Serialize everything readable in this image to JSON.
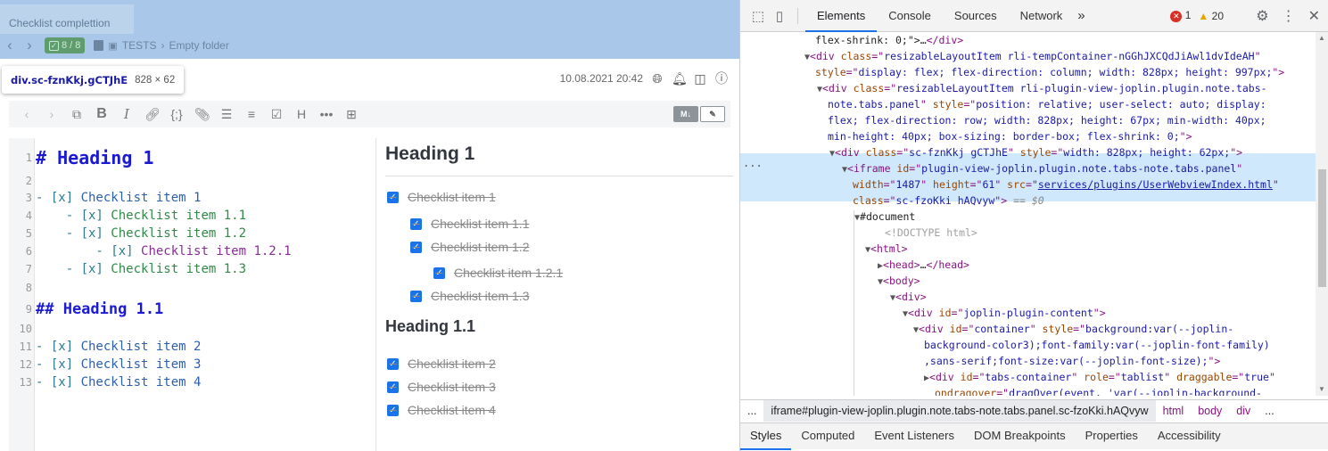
{
  "app": {
    "tab_title": "Checklist complettion",
    "navbar": {
      "back_icon": "chevron-left",
      "forward_icon": "chevron-right",
      "todo_badge": "8 / 8",
      "notebook": "TESTS",
      "folder": "Empty folder"
    },
    "tooltip": {
      "selector": "div.sc-fznKkj.gCTJhE",
      "size": "828 × 62"
    },
    "header": {
      "datetime": "10.08.2021 20:42"
    },
    "editor_toolbar": {
      "toggle_markdown": "M↓",
      "toggle_edit": "✎"
    },
    "editor_lines": [
      {
        "n": "1",
        "text": "# Heading 1",
        "kind": "h1"
      },
      {
        "n": "2",
        "text": "",
        "kind": "blank"
      },
      {
        "n": "3",
        "mark": "- [x] ",
        "text": "Checklist item 1",
        "kind": "l0"
      },
      {
        "n": "4",
        "mark": "    - [x] ",
        "text": "Checklist item 1.1",
        "kind": "l1"
      },
      {
        "n": "5",
        "mark": "    - [x] ",
        "text": "Checklist item 1.2",
        "kind": "l1"
      },
      {
        "n": "6",
        "mark": "        - [x] ",
        "text": "Checklist item 1.2.1",
        "kind": "l2"
      },
      {
        "n": "7",
        "mark": "    - [x] ",
        "text": "Checklist item 1.3",
        "kind": "l1"
      },
      {
        "n": "8",
        "text": "",
        "kind": "blank"
      },
      {
        "n": "9",
        "text": "## Heading 1.1",
        "kind": "h2"
      },
      {
        "n": "10",
        "text": "",
        "kind": "blank"
      },
      {
        "n": "11",
        "mark": "- [x] ",
        "text": "Checklist item 2",
        "kind": "l0"
      },
      {
        "n": "12",
        "mark": "- [x] ",
        "text": "Checklist item 3",
        "kind": "l0"
      },
      {
        "n": "13",
        "mark": "- [x] ",
        "text": "Checklist item 4",
        "kind": "l0"
      }
    ],
    "viewer": {
      "heading1": "Heading 1",
      "items1": [
        {
          "text": "Checklist item 1",
          "level": 0
        },
        {
          "text": "Checklist item 1.1",
          "level": 1
        },
        {
          "text": "Checklist item 1.2",
          "level": 1
        },
        {
          "text": "Checklist item 1.2.1",
          "level": 2
        },
        {
          "text": "Checklist item 1.3",
          "level": 1
        }
      ],
      "heading2": "Heading 1.1",
      "items2": [
        {
          "text": "Checklist item 2",
          "level": 0
        },
        {
          "text": "Checklist item 3",
          "level": 0
        },
        {
          "text": "Checklist item 4",
          "level": 0
        }
      ]
    }
  },
  "devtools": {
    "tabs": [
      "Elements",
      "Console",
      "Sources",
      "Network"
    ],
    "active_tab": "Elements",
    "more_tabs": "»",
    "errors": "1",
    "warnings": "20",
    "dom_lines": [
      {
        "indent": 0,
        "html": "<span class=\"tx\">flex-shrink: 0;\">…</span><span class=\"t\">&lt;/div&gt;</span>"
      },
      {
        "indent": 0,
        "html": "<span class=\"tri\">▼</span><span class=\"t\">&lt;div </span><span class=\"an\">class</span><span class=\"t\">=\"</span><span class=\"av\">resizableLayoutItem rli-tempContainer-nGGhJXCQdJiAwl1dvIdeAH</span><span class=\"t\">\"</span>"
      },
      {
        "indent": 0,
        "html": "<span class=\"an\">style</span><span class=\"t\">=\"</span><span class=\"av\">display: flex; flex-direction: column; width: 828px; height: 997px;</span><span class=\"t\">\"&gt;</span>"
      },
      {
        "indent": 1,
        "html": "<span class=\"tri\">▼</span><span class=\"t\">&lt;div </span><span class=\"an\">class</span><span class=\"t\">=\"</span><span class=\"av\">resizableLayoutItem rli-plugin-view-joplin.plugin.note.tabs-</span>"
      },
      {
        "indent": 1,
        "html": "<span class=\"av\">note.tabs.panel</span><span class=\"t\">\" </span><span class=\"an\">style</span><span class=\"t\">=\"</span><span class=\"av\">position: relative; user-select: auto; display:</span>"
      },
      {
        "indent": 1,
        "html": "<span class=\"av\">flex; flex-direction: row; width: 828px; height: 67px; min-width: 40px;</span>"
      },
      {
        "indent": 1,
        "html": "<span class=\"av\">min-height: 40px; box-sizing: border-box; flex-shrink: 0;</span><span class=\"t\">\"&gt;</span>"
      },
      {
        "indent": 2,
        "html": "<span class=\"tri\">▼</span><span class=\"t\">&lt;div </span><span class=\"an\">class</span><span class=\"t\">=\"</span><span class=\"av\">sc-fznKkj gCTJhE</span><span class=\"t\">\" </span><span class=\"an\">style</span><span class=\"t\">=\"</span><span class=\"av\">width: 828px; height: 62px;</span><span class=\"t\">\"&gt;</span>"
      },
      {
        "indent": 3,
        "html": "<span class=\"tri\">▼</span><span class=\"t\">&lt;iframe </span><span class=\"an\">id</span><span class=\"t\">=\"</span><span class=\"av\">plugin-view-joplin.plugin.note.tabs-note.tabs.panel</span><span class=\"t\">\"</span>"
      },
      {
        "indent": 3,
        "html": "<span class=\"an\">width</span><span class=\"t\">=\"</span><span class=\"av\">1487</span><span class=\"t\">\" </span><span class=\"an\">height</span><span class=\"t\">=\"</span><span class=\"av\">61</span><span class=\"t\">\" </span><span class=\"an\">src</span><span class=\"t\">=\"</span><span class=\"lk\">services/plugins/UserWebviewIndex.html</span><span class=\"t\">\"</span>"
      },
      {
        "indent": 3,
        "html": "<span class=\"an\">class</span><span class=\"t\">=\"</span><span class=\"av\">sc-fzoKki hAQvyw</span><span class=\"t\">\"&gt;</span> <span class=\"eq\">== $0</span>"
      },
      {
        "indent": 4,
        "html": "<span class=\"tri\">▼</span><span class=\"tx\">#document</span>"
      },
      {
        "indent": 5,
        "html": "<span class=\"cm\">&lt;!DOCTYPE html&gt;</span>"
      },
      {
        "indent": 5,
        "html": "<span class=\"tri\">▼</span><span class=\"t\">&lt;html&gt;</span>"
      },
      {
        "indent": 6,
        "html": "<span class=\"tri\">▶</span><span class=\"t\">&lt;head&gt;</span><span class=\"tx\">…</span><span class=\"t\">&lt;/head&gt;</span>"
      },
      {
        "indent": 6,
        "html": "<span class=\"tri\">▼</span><span class=\"t\">&lt;body&gt;</span>"
      },
      {
        "indent": 7,
        "html": "<span class=\"tri\">▼</span><span class=\"t\">&lt;div&gt;</span>"
      },
      {
        "indent": 8,
        "html": "<span class=\"tri\">▼</span><span class=\"t\">&lt;div </span><span class=\"an\">id</span><span class=\"t\">=\"</span><span class=\"av\">joplin-plugin-content</span><span class=\"t\">\"&gt;</span>"
      },
      {
        "indent": 9,
        "html": "<span class=\"tri\">▼</span><span class=\"t\">&lt;div </span><span class=\"an\">id</span><span class=\"t\">=\"</span><span class=\"av\">container</span><span class=\"t\">\" </span><span class=\"an\">style</span><span class=\"t\">=\"</span><span class=\"av\">background:var(--joplin-</span>"
      },
      {
        "indent": 9,
        "html": "<span class=\"av\">background-color3);font-family:var(--joplin-font-family)</span>"
      },
      {
        "indent": 9,
        "html": "<span class=\"av\">,sans-serif;font-size:var(--joplin-font-size);</span><span class=\"t\">\"&gt;</span>"
      },
      {
        "indent": 10,
        "html": "<span class=\"tri\">▶</span><span class=\"t\">&lt;div </span><span class=\"an\">id</span><span class=\"t\">=\"</span><span class=\"av\">tabs-container</span><span class=\"t\">\" </span><span class=\"an\">role</span><span class=\"t\">=\"</span><span class=\"av\">tablist</span><span class=\"t\">\" </span><span class=\"an\">draggable</span><span class=\"t\">=\"</span><span class=\"av\">true</span><span class=\"t\">\"</span>"
      },
      {
        "indent": 10,
        "html": "<span class=\"an\">ondragover</span><span class=\"t\">=\"</span><span class=\"av\">dragOver(event, 'var(--joplin-background-</span>"
      }
    ],
    "breadcrumb": [
      "...",
      "iframe#plugin-view-joplin.plugin.note.tabs-note.tabs.panel.sc-fzoKki.hAQvyw",
      "html",
      "body",
      "div",
      "..."
    ],
    "bottom_tabs": [
      "Styles",
      "Computed",
      "Event Listeners",
      "DOM Breakpoints",
      "Properties",
      "Accessibility"
    ],
    "active_bottom_tab": "Styles",
    "selected_dots": "..."
  }
}
